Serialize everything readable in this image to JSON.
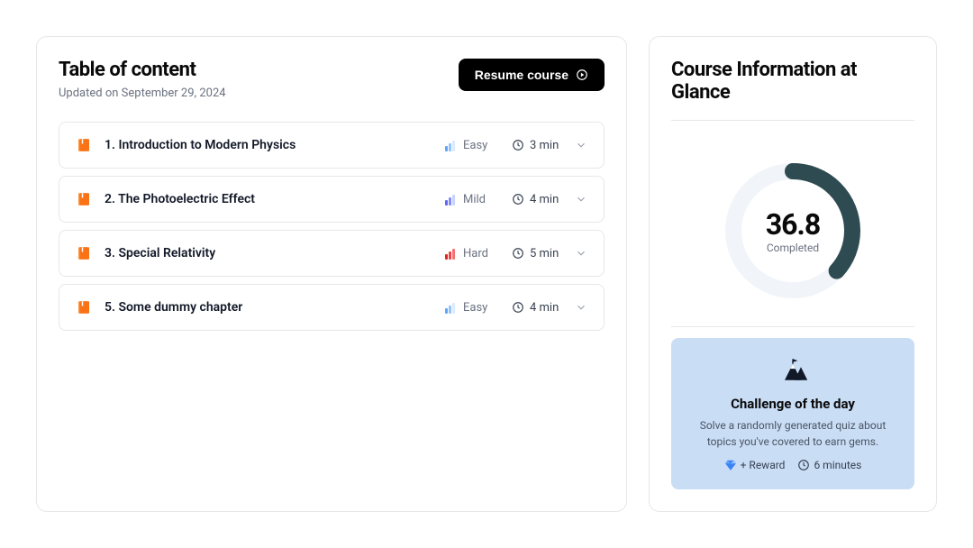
{
  "toc": {
    "title": "Table of content",
    "updated": "Updated on September 29, 2024",
    "resume_label": "Resume course",
    "chapters": [
      {
        "title": "1. Introduction to Modern Physics",
        "difficulty": "Easy",
        "duration": "3 min"
      },
      {
        "title": "2. The Photoelectric Effect",
        "difficulty": "Mild",
        "duration": "4 min"
      },
      {
        "title": "3. Special Relativity",
        "difficulty": "Hard",
        "duration": "5 min"
      },
      {
        "title": "5. Some dummy chapter",
        "difficulty": "Easy",
        "duration": "4 min"
      }
    ]
  },
  "info": {
    "title": "Course Information at Glance",
    "progress_value": "36.8",
    "progress_label": "Completed",
    "progress_percent": 36.8
  },
  "challenge": {
    "title": "Challenge of the day",
    "description": "Solve a randomly generated quiz about topics you've covered to earn gems.",
    "reward": "+ Reward",
    "time": "6 minutes"
  },
  "difficulty_colors": {
    "Easy": {
      "b1": "#60a5fa",
      "b2": "#93c5fd",
      "b3": "#dbeafe"
    },
    "Mild": {
      "b1": "#6366f1",
      "b2": "#818cf8",
      "b3": "#c7d2fe"
    },
    "Hard": {
      "b1": "#dc2626",
      "b2": "#ef4444",
      "b3": "#f87171"
    }
  }
}
